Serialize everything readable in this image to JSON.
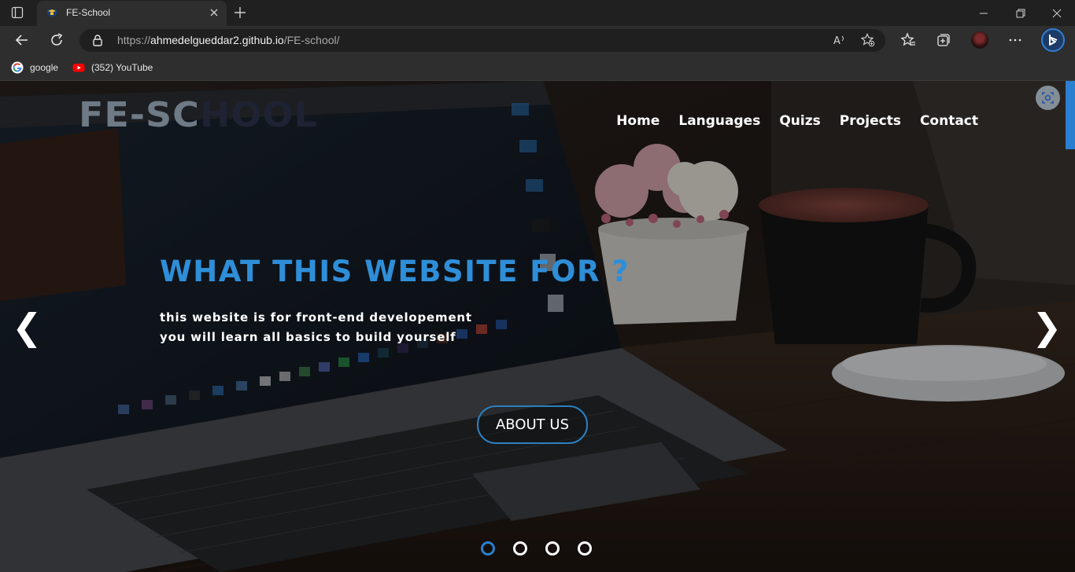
{
  "browser": {
    "tab": {
      "title": "FE-School"
    },
    "address": {
      "prefix": "https://",
      "host": "ahmedelgueddar2.github.io",
      "path": "/FE-school/"
    },
    "bookmarks": [
      {
        "label": "google",
        "icon": "google-icon"
      },
      {
        "label": "(352) YouTube",
        "icon": "youtube-icon"
      }
    ]
  },
  "page": {
    "logo": {
      "part1": "FE-SC",
      "part2": "HOOL"
    },
    "nav": [
      "Home",
      "Languages",
      "Quizs",
      "Projects",
      "Contact"
    ],
    "hero": {
      "title": "WHAT THIS WEBSITE FOR ?",
      "line1": "this website is for front-end developement",
      "line2": "you will learn all basics to build yourself",
      "button": "ABOUT US"
    },
    "carousel": {
      "prev": "❮",
      "next": "❯",
      "slides": 4,
      "active_slide": 1
    }
  },
  "colors": {
    "accent": "#2f8ed8",
    "button_border": "#2d7fc0",
    "chrome_bg": "#2e2e2e"
  }
}
